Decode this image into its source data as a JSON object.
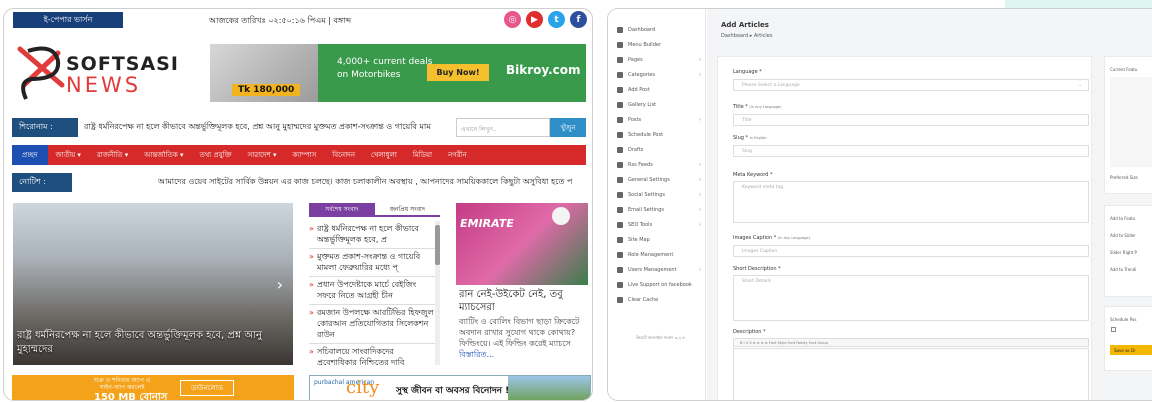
{
  "news": {
    "epaper_label": "ই-পেপার ভার্সন",
    "datetime_text": "আজকের তারিখঃ ০২:৫০:১৬ পিএম | বঙ্গাব্দ",
    "logo_top": "SOFTSASI",
    "logo_bottom": "NEWS",
    "ad_banner": {
      "price": "Tk 180,000",
      "line1": "4,000+ current deals",
      "line2": "on Motorbikes",
      "cta": "Buy Now!",
      "brand": "Bikroy.com"
    },
    "headline_label": "শিরোনাম :",
    "headline_ticker": "রাষ্ট্র ধর্মনিরপেক্ষ না হলে কীভাবে অন্তর্ভুক্তিমূলক হবে, প্রশ্ন আনু মুহাম্মদের  মুক্তমত প্রকাশ-সংক্রান্ত ও গায়েবি মাম",
    "search_placeholder": "এখানে লিখুন..",
    "search_button": "খুঁজুন",
    "nav": [
      "প্রচ্ছদ",
      "জাতীয় ▾",
      "রাজনীতি ▾",
      "আন্তর্জাতিক ▾",
      "তথ্য প্রযুক্তি",
      "সারাদেশ ▾",
      "ক্যাম্পাস",
      "বিনোদন",
      "খেলাধুলা",
      "মিডিয়া",
      "নগরীন"
    ],
    "notice_label": "নোটিশ :",
    "notice_ticker": "আমাদের ওয়েব সাইটের সার্বিক উন্নয়ন এর কাজ চলছে। কাজ চলাকালীন অবস্থায় , আপনাদের সাময়িককালে কিছুটা অসুবিধা হতে প",
    "hero_caption": "রাষ্ট্র ধর্মনিরপেক্ষ না হলে কীভাবে অন্তর্ভুক্তিমূলক হবে, প্রশ্ন আনু মুহাম্মদের",
    "tabs": [
      "সর্বশেষ সংবাদ",
      "জনপ্রিয় সংবাদ"
    ],
    "latest": [
      "রাষ্ট্র ধর্মনিরপেক্ষ না হলে কীভাবে অন্তর্ভুক্তিমূলক হবে, প্র",
      "মুক্তমত প্রকাশ-সংক্রান্ত ও গায়েবি মামলা ফেব্রুয়ারির মধ্যে প্",
      "প্রধান উপদেষ্টাকে মার্চে বেইজিং সফরে নিতে আগ্রহী চীন",
      "রমজান উপলক্ষে আরটিভির হিফজুল কোরআন প্রতিযোগিতার সিলেকশন রাউন",
      "সচিবালয়ে সাংবাদিকদের প্রবেশাধিকার নিশ্চিতের দাবি"
    ],
    "card_art_text": "EMIRATE",
    "card_title": "রান নেই-উইকেট নেই, তবু ম্যাচসেরা",
    "card_body": "ব্যাটিং ও বোলিং বিভাগ ছাড়া ক্রিকেটে অবদান রাখার সুযোগ থাকে কোথায়? ফিল্ডিংয়ে। এই ফিল্ডিং করেই ম্যাচসে",
    "card_more": "বিস্তারিত...",
    "ad_gp_text": "শুক্র ও শনিবার অ্যাপ এ সাইন-আপ করলেই",
    "ad_gp_big": "150 MB বোনাস",
    "ad_gp_cta": "ডাউনলোড",
    "ad_city_small": "purbachal american",
    "ad_city": "city",
    "ad_city_slogan": "সুস্থ জীবন বা অবসর বিনোদন !"
  },
  "admin": {
    "sidebar": [
      "Dashboard",
      "Menu Builder",
      "Pages",
      "Categories",
      "Add Post",
      "Gallery List",
      "Posts",
      "Schedule Post",
      "Drafts",
      "Rss Feeds",
      "General Settings",
      "Social Settings",
      "Email Settings",
      "SEO Tools",
      "Site Map",
      "Role Management",
      "Users Management",
      "Live Support on facebook",
      "Clear Cache"
    ],
    "sidebar_footer": "ক্রিয়েট অনলাইন সংবাদ ৩.২.৮",
    "page_title": "Add Articles",
    "breadcrumb": "Dashboard  ▸  Articles",
    "fields": {
      "language_label": "Language *",
      "language_value": "Please Select a Language",
      "title_label": "Title *",
      "title_note": "(In Any Language)",
      "title_ph": "Title",
      "slug_label": "Slug *",
      "slug_note": "In English",
      "slug_ph": "Slug",
      "meta_label": "Meta Keyword *",
      "meta_ph": "Keyword meta tag",
      "caption_label": "Images Caption *",
      "caption_note": "(In Any Language)",
      "caption_ph": "Images Caption",
      "short_label": "Short Description *",
      "short_ph": "Short Details",
      "desc_label": "Description *",
      "toolbar": "B  I  U  S  ≡  ≡  ≡  ≡    Font Style    Font Family    Font Group"
    },
    "right": {
      "current_feat": "Current Featu",
      "preferred": "Preferred Size",
      "add_feat": "Add to Featu",
      "add_slider": "Add to Slider",
      "slider_right": "Slider Right P",
      "add_trend": "Add to Trendi",
      "schedule": "Schedule Pos",
      "save": "Save as Dr"
    }
  },
  "colors": {
    "nav_red": "#d62a2a",
    "nav_active": "#1d4fb0",
    "label_blue": "#1e4f7e",
    "save_yellow": "#f5b800"
  }
}
